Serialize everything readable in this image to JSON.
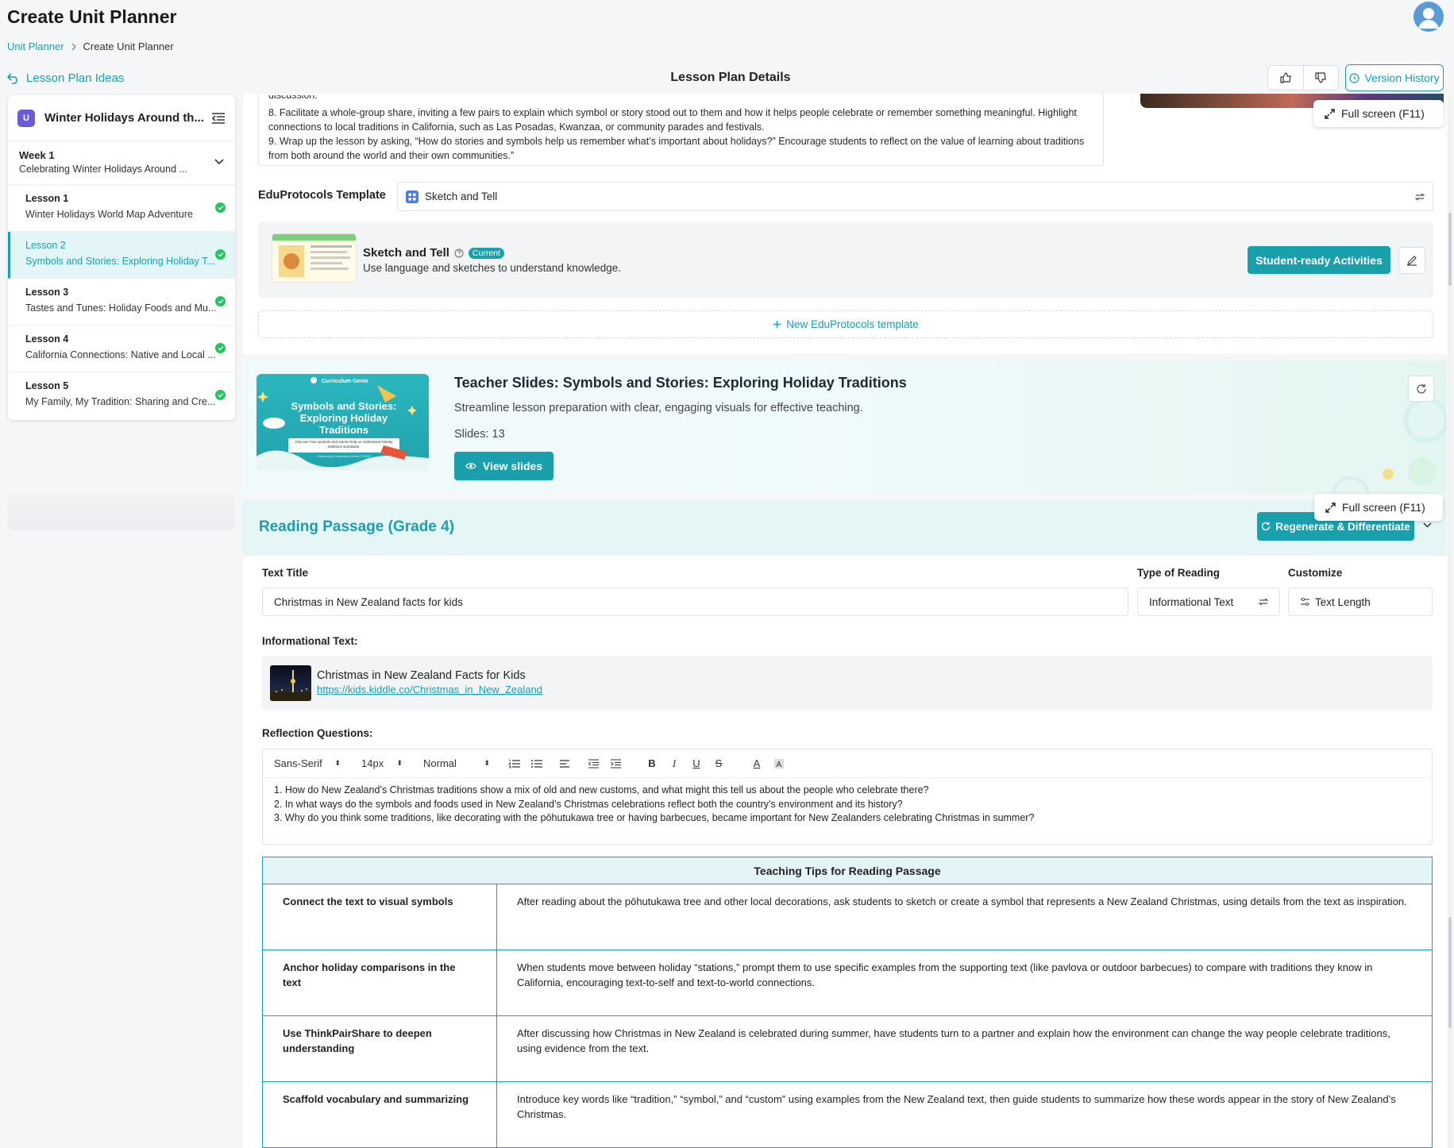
{
  "header": {
    "title": "Create Unit Planner",
    "breadcrumb": [
      "Unit Planner",
      "Create Unit Planner"
    ],
    "back_link": "Lesson Plan Ideas",
    "details_title": "Lesson Plan Details",
    "version_history": "Version History"
  },
  "sidebar": {
    "unit_title": "Winter Holidays Around th...",
    "unit_logo": "U",
    "week": {
      "label": "Week 1",
      "title": "Celebrating Winter Holidays Around ..."
    },
    "lessons": [
      {
        "label": "Lesson 1",
        "title": "Winter Holidays World Map Adventure"
      },
      {
        "label": "Lesson 2",
        "title": "Symbols and Stories: Exploring Holiday T..."
      },
      {
        "label": "Lesson 3",
        "title": "Tastes and Tunes: Holiday Foods and Mu..."
      },
      {
        "label": "Lesson 4",
        "title": "California Connections: Native and Local ..."
      },
      {
        "label": "Lesson 5",
        "title": "My Family, My Tradition: Sharing and Cre..."
      }
    ]
  },
  "lesson_plan": {
    "cut_text": "discussion.",
    "steps": [
      "8. Facilitate a whole-group share, inviting a few pairs to explain which symbol or story stood out to them and how it helps people celebrate or remember something meaningful. Highlight connections to local traditions in California, such as Las Posadas, Kwanzaa, or community parades and festivals.",
      "9. Wrap up the lesson by asking, “How do stories and symbols help us remember what’s important about holidays?” Encourage students to reflect on the value of learning about traditions from both around the world and their own communities.”"
    ],
    "fullscreen": "Full screen (F11)"
  },
  "eduprotocols": {
    "label": "EduProtocols Template",
    "selected": "Sketch and Tell",
    "template_name": "Sketch and Tell",
    "badge": "Current",
    "description": "Use language and sketches to understand knowledge.",
    "student_ready": "Student-ready Activities",
    "new_template": "New EduProtocols template"
  },
  "slides": {
    "title": "Teacher Slides: Symbols and Stories: Exploring Holiday Traditions",
    "description": "Streamline lesson preparation with clear, engaging visuals for effective teaching.",
    "count": "Slides: 13",
    "view": "View slides",
    "thumb_brand": "Curriculum Genie",
    "thumb_title": "Symbols and Stories: Exploring Holiday Traditions",
    "thumb_sub": "Discover how symbols and stories help us understand holiday traditions worldwide.",
    "thumb_footer": "Powered by Curriculum Genie © 2025"
  },
  "reading": {
    "title": "Reading Passage (Grade 4)",
    "regenerate": "Regenerate & Differentiate",
    "fullscreen": "Full screen (F11)",
    "text_title_label": "Text Title",
    "text_title_value": "Christmas in New Zealand facts for kids",
    "type_label": "Type of Reading",
    "type_value": "Informational Text",
    "customize_label": "Customize",
    "customize_value": "Text Length",
    "info_label": "Informational Text:",
    "link_title": "Christmas in New Zealand Facts for Kids",
    "link_url": "https://kids.kiddle.co/Christmas_in_New_Zealand",
    "reflection_label": "Reflection Questions:",
    "toolbar": {
      "font": "Sans-Serif",
      "size": "14px",
      "style": "Normal"
    },
    "questions": [
      "1. How do New Zealand’s Christmas traditions show a mix of old and new customs, and what might this tell us about the people who celebrate there?",
      "2. In what ways do the symbols and foods used in New Zealand’s Christmas celebrations reflect both the country’s environment and its history?",
      "3. Why do you think some traditions, like decorating with the pōhutukawa tree or having barbecues, became important for New Zealanders celebrating Christmas in summer?"
    ]
  },
  "tips": {
    "header": "Teaching Tips for Reading Passage",
    "rows": [
      {
        "key": "Connect the text to visual symbols",
        "value": "After reading about the pōhutukawa tree and other local decorations, ask students to sketch or create a symbol that represents a New Zealand Christmas, using details from the text as inspiration."
      },
      {
        "key": "Anchor holiday comparisons in the text",
        "value": "When students move between holiday “stations,” prompt them to use specific examples from the supporting text (like pavlova or outdoor barbecues) to compare with traditions they know in California, encouraging text-to-self and text-to-world connections."
      },
      {
        "key": "Use ThinkPairShare to deepen understanding",
        "value": "After discussing how Christmas in New Zealand is celebrated during summer, have students turn to a partner and explain how the environment can change the way people celebrate traditions, using evidence from the text."
      },
      {
        "key": "Scaffold vocabulary and summarizing",
        "value": "Introduce key words like “tradition,” “symbol,” and “custom” using examples from the New Zealand text, then guide students to summarize how these words appear in the story of New Zealand’s Christmas."
      }
    ]
  },
  "colors": {
    "accent": "#1aa0ad",
    "success": "#22c55e",
    "unit_logo": "#6b5bd6"
  }
}
